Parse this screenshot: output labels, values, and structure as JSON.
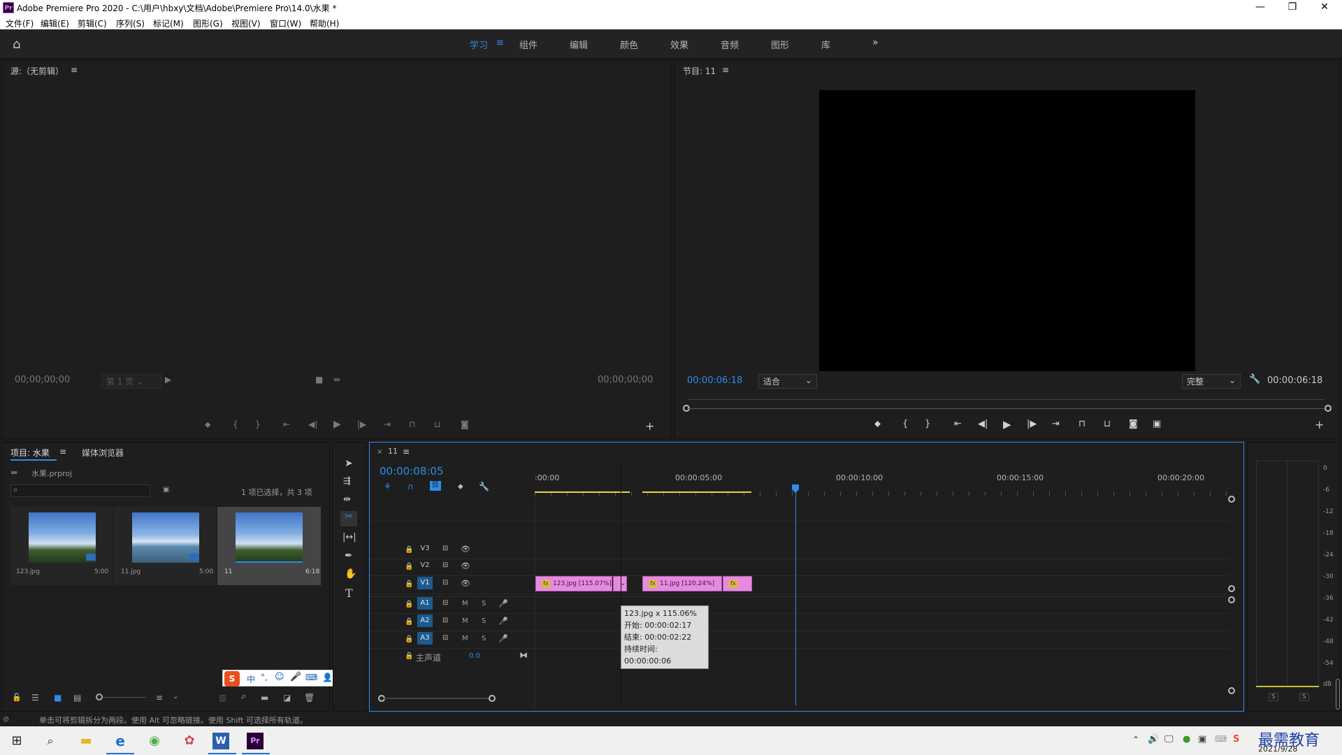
{
  "window": {
    "title": "Adobe Premiere Pro 2020 - C:\\用户\\hbxy\\文档\\Adobe\\Premiere Pro\\14.0\\水果 *",
    "logo": "Pr"
  },
  "menu": [
    "文件(F)",
    "编辑(E)",
    "剪辑(C)",
    "序列(S)",
    "标记(M)",
    "图形(G)",
    "视图(V)",
    "窗口(W)",
    "帮助(H)"
  ],
  "workspaces": [
    "学习",
    "组件",
    "编辑",
    "颜色",
    "效果",
    "音频",
    "图形",
    "库"
  ],
  "source": {
    "title": "源:（无剪辑）",
    "tc_left": "00;00;00;00",
    "page": "第 1 页",
    "tc_right": "00;00;00;00"
  },
  "program": {
    "title": "节目: 11",
    "tc_current": "00:00:06:18",
    "fit": "适合",
    "quality": "完整",
    "tc_duration": "00:00:06:18"
  },
  "project": {
    "tabs": [
      "项目: 水果",
      "媒体浏览器"
    ],
    "file": "水果.prproj",
    "selection": "1 项已选择，共 3 项",
    "items": [
      {
        "name": "123.jpg",
        "dur": "5:00"
      },
      {
        "name": "11.jpg",
        "dur": "5:00"
      },
      {
        "name": "11",
        "dur": "6:18"
      }
    ]
  },
  "timeline": {
    "tab": "11",
    "tc": "00:00:08:05",
    "ruler": [
      ":00:00",
      "00:00:05:00",
      "00:00:10:00",
      "00:00:15:00",
      "00:00:20:00"
    ],
    "video_tracks": [
      "V3",
      "V2",
      "V1"
    ],
    "audio_tracks": [
      "A1",
      "A2",
      "A3"
    ],
    "mute": "M",
    "solo": "S",
    "master_label": "主声道",
    "master_value": "0.0",
    "clips": [
      {
        "label": "123.jpg [115.07%]"
      },
      {
        "label": "11.jpg [120.24%]"
      }
    ],
    "fx": "fx",
    "tooltip": [
      "123.jpg x 115.06%",
      "开始: 00:00:02:17",
      "结束: 00:00:02:22",
      "持续时间: 00:00:00:06"
    ]
  },
  "vu": {
    "scale": [
      "0",
      "-6",
      "-12",
      "-18",
      "-24",
      "-30",
      "-36",
      "-42",
      "-48",
      "-54",
      "dB"
    ],
    "solo": [
      "S",
      "S"
    ]
  },
  "ime": {
    "logo": "S",
    "mode": "中"
  },
  "status": "单击可将剪辑拆分为两段。使用 Alt 可忽略链接。使用 Shift 可选择所有轨道。",
  "taskbar": {
    "date": "2021/9/28",
    "brand": "最需教育"
  }
}
